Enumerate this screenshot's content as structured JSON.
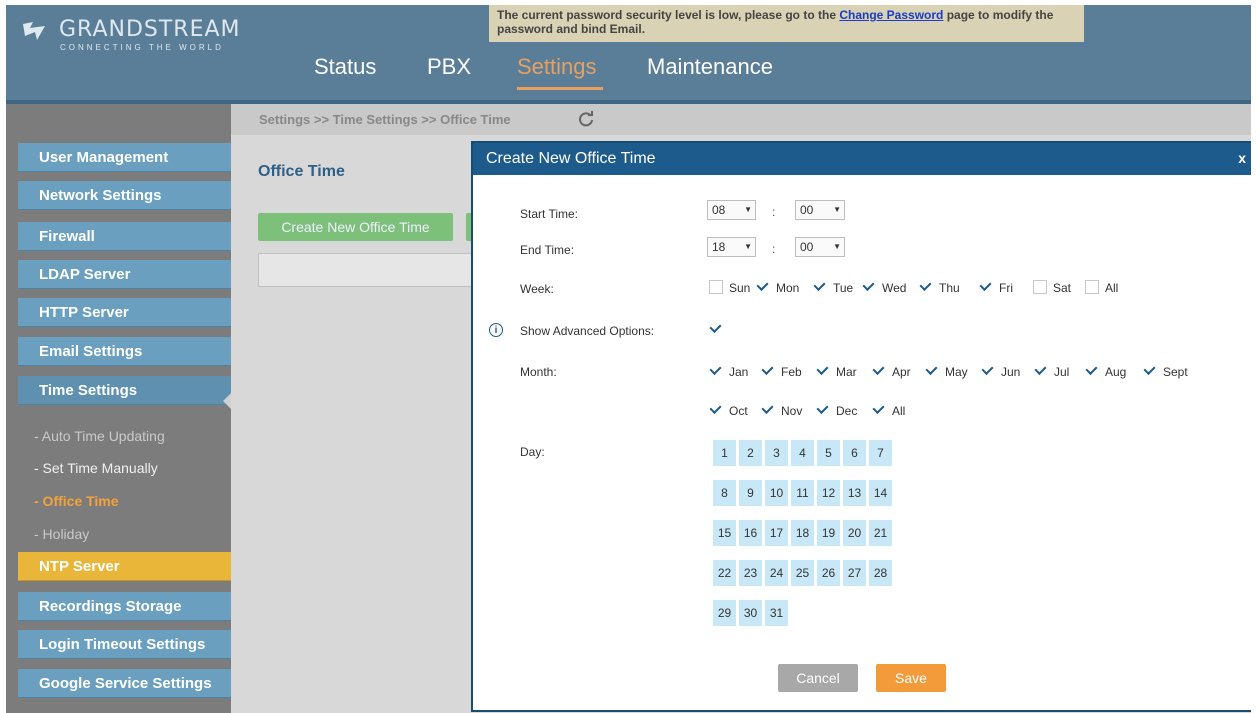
{
  "header": {
    "brand": "GRANDSTREAM",
    "tagline": "CONNECTING THE WORLD",
    "alert_prefix": "The current password security level is low, please go to the",
    "alert_link": "Change Password",
    "alert_suffix": "page to modify the password and bind Email.",
    "nav": [
      "Status",
      "PBX",
      "Settings",
      "Maintenance"
    ],
    "nav_active": "Settings"
  },
  "sidebar": {
    "items": [
      "User Management",
      "Network Settings",
      "Firewall",
      "LDAP Server",
      "HTTP Server",
      "Email Settings",
      "Time Settings",
      "NTP Server",
      "Recordings Storage",
      "Login Timeout Settings",
      "Google Service Settings"
    ],
    "time_sub_items": [
      "- Auto Time Updating",
      "- Set Time Manually",
      "- Office Time",
      "- Holiday"
    ]
  },
  "breadcrumb": "Settings >> Time Settings >> Office Time",
  "page": {
    "title": "Office Time",
    "create_button": "Create New Office Time"
  },
  "dialog": {
    "title": "Create New Office Time",
    "close": "x",
    "start_time_label": "Start Time:",
    "start_hour": "08",
    "start_minute": "00",
    "end_time_label": "End Time:",
    "end_hour": "18",
    "end_minute": "00",
    "colon": ":",
    "week_label": "Week:",
    "week": [
      {
        "label": "Sun",
        "checked": false
      },
      {
        "label": "Mon",
        "checked": true
      },
      {
        "label": "Tue",
        "checked": true
      },
      {
        "label": "Wed",
        "checked": true
      },
      {
        "label": "Thu",
        "checked": true
      },
      {
        "label": "Fri",
        "checked": true
      },
      {
        "label": "Sat",
        "checked": false
      },
      {
        "label": "All",
        "checked": false
      }
    ],
    "advanced_label": "Show Advanced Options:",
    "advanced_checked": true,
    "month_label": "Month:",
    "months": [
      {
        "label": "Jan",
        "checked": true
      },
      {
        "label": "Feb",
        "checked": true
      },
      {
        "label": "Mar",
        "checked": true
      },
      {
        "label": "Apr",
        "checked": true
      },
      {
        "label": "May",
        "checked": true
      },
      {
        "label": "Jun",
        "checked": true
      },
      {
        "label": "Jul",
        "checked": true
      },
      {
        "label": "Aug",
        "checked": true
      },
      {
        "label": "Sept",
        "checked": true
      },
      {
        "label": "Oct",
        "checked": true
      },
      {
        "label": "Nov",
        "checked": true
      },
      {
        "label": "Dec",
        "checked": true
      },
      {
        "label": "All",
        "checked": true
      }
    ],
    "day_label": "Day:",
    "days": [
      "1",
      "2",
      "3",
      "4",
      "5",
      "6",
      "7",
      "8",
      "9",
      "10",
      "11",
      "12",
      "13",
      "14",
      "15",
      "16",
      "17",
      "18",
      "19",
      "20",
      "21",
      "22",
      "23",
      "24",
      "25",
      "26",
      "27",
      "28",
      "29",
      "30",
      "31"
    ],
    "cancel": "Cancel",
    "save": "Save"
  }
}
